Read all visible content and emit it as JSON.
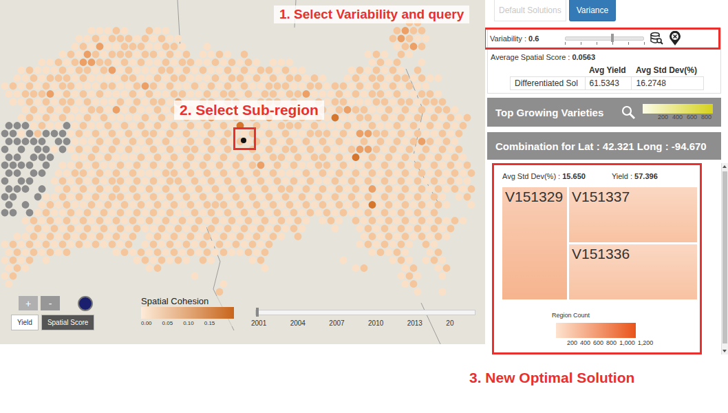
{
  "annotations": [
    {
      "text": "1. Select Variability and query"
    },
    {
      "text": "2. Select Sub-region"
    },
    {
      "text": "3. New Optimal Solution"
    }
  ],
  "map": {
    "grid": [
      "..........................................................",
      "..........................................................",
      ".................................................22.......",
      "..........11121..211...........................2322......",
      ".........1121222121211.........................23211.....",
      "........12131122211221..1......................1232......",
      ".......1213212221221212.1121.2..............121.21.......",
      "....112123322121211212211212121.111.........1212..1......",
      "..12111212212312111221212112121221211.....1212121.2......",
      ".11212221211112211212211121221212122121..121221221211....",
      "1212121221112211232121121212121122211221221212121211....",
      "11222312121211121211221121221212212231112121221211221...",
      ".11212122121112121221311221221122212112122111221221222..",
      "..12121211221312112121212121121212121221232211212121221.",
      "..1212121121211112121121231121213121212141122121212121212",
      "ggg1211g121121212121212121214121122212111211211212121212",
      "gg1g2ggg121212121221212112121121212112221213322121211212",
      "ggggg.gg11121212121211212121212121212121211212121232121",
      "g.g.gg1g121212121121212212121121212212121123321212121212",
      "gg.ggg..112121112121212121212121221212212141212121212121",
      "gggg.g.11212112121212121212121231212112212112121212121212",
      "gg.gg.112212121211122121212121212111212121212121212121212",
      "g.gg..121212122121212212121212121212121121212121212121211",
      "ggg.g.121212121212121212121212121221212121213121212121212",
      "gg..g1121212122121212121212121212121212121212121212121.12",
      "g.g.12121121212121212121222121212121212121214121212121..1",
      "gg.g1211212121212121211212121212121212121211212121212....",
      "..12121212121212121212121212121212121.121.21212121212121.",
      "...1212121212121211212121212121212121...1..121212121212..",
      ".112121212121212.12121212121212121.2.......12121212121...",
      "1212121212121212.1212121212121212..........1212121.21....",
      "12121212.....1212121212121211212............12121..12....",
      "1212.1..........1212121.21....12.........1.....121.121...",
      "121..............12............1..........12....12..12...",
      "12.....................1........................121..1...",
      "1.........................1.....................12.......",
      "..........................2.......................1..1..."
    ],
    "selected": true,
    "zoom_in": "+",
    "zoom_out": "-",
    "layer_buttons": [
      {
        "label": "Yield",
        "selected": false
      },
      {
        "label": "Spatial Score",
        "selected": true
      }
    ],
    "legend": {
      "title": "Spatial Cohesion",
      "ticks": [
        "0.00",
        "0.05",
        "0.10",
        "0.15"
      ]
    },
    "timeline": {
      "ticks": [
        "2001",
        "2004",
        "2007",
        "2010",
        "2013",
        "20"
      ],
      "level": 0.0
    }
  },
  "tabs": [
    {
      "label": "Default Solutions",
      "selected": false
    },
    {
      "label": "Variance",
      "selected": true
    }
  ],
  "variability": {
    "label": "Variability : ",
    "value": "0.6",
    "level": 0.6
  },
  "avg_spatial_score": {
    "label": "Average Spatial Score : ",
    "value": "0.0563"
  },
  "summary_table": {
    "columns": [
      "",
      "Avg Yield",
      "Avg Std Dev(%)"
    ],
    "rows": [
      [
        "Differentiated Sol",
        "61.5343",
        "16.2748"
      ]
    ]
  },
  "top_growing": {
    "title": "Top Growing Varieties",
    "legend_ticks": [
      "200",
      "400",
      "600",
      "800"
    ]
  },
  "combination": {
    "title": "Combination for Lat : 42.321 Long : -94.670",
    "std_label": "Avg Std Dev(%) : ",
    "std_value": "15.650",
    "yield_label": "Yield : ",
    "yield_value": "57.396",
    "varieties": [
      {
        "name": "V151329",
        "color": "#f6b48e"
      },
      {
        "name": "V151337",
        "color": "#f8c2a2"
      },
      {
        "name": "V151336",
        "color": "#f8c2a2"
      }
    ],
    "legend": {
      "title": "Region Count",
      "ticks": [
        "200",
        "400",
        "600",
        "800",
        "1,000",
        "1,200"
      ]
    }
  }
}
